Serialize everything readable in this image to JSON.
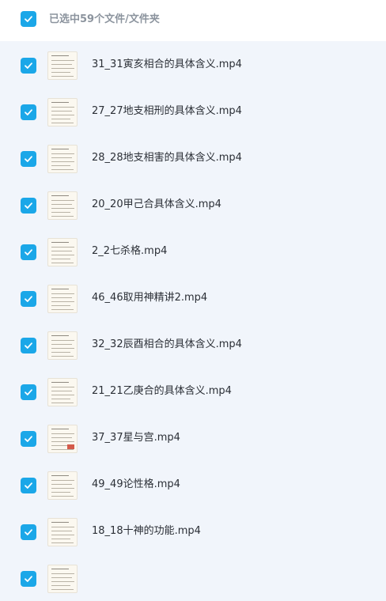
{
  "header": {
    "title": "已选中59个文件/文件夹"
  },
  "colors": {
    "accent": "#1ba7e8",
    "background": "#f1f5fb",
    "text": "#2b2f36",
    "header_text": "#8c949e"
  },
  "icons": {
    "checkbox": "checkmark-icon",
    "thumbnail": "video-thumbnail-icon"
  },
  "files": [
    {
      "name": "31_31寅亥相合的具体含义.mp4",
      "checked": true
    },
    {
      "name": "27_27地支相刑的具体含义.mp4",
      "checked": true
    },
    {
      "name": "28_28地支相害的具体含义.mp4",
      "checked": true
    },
    {
      "name": "20_20甲己合具体含义.mp4",
      "checked": true
    },
    {
      "name": "2_2七杀格.mp4",
      "checked": true
    },
    {
      "name": "46_46取用神精讲2.mp4",
      "checked": true
    },
    {
      "name": "32_32辰酉相合的具体含义.mp4",
      "checked": true
    },
    {
      "name": "21_21乙庚合的具体含义.mp4",
      "checked": true
    },
    {
      "name": "37_37星与宫.mp4",
      "checked": true
    },
    {
      "name": "49_49论性格.mp4",
      "checked": true
    },
    {
      "name": "18_18十神的功能.mp4",
      "checked": true
    },
    {
      "name": "",
      "checked": true
    }
  ]
}
